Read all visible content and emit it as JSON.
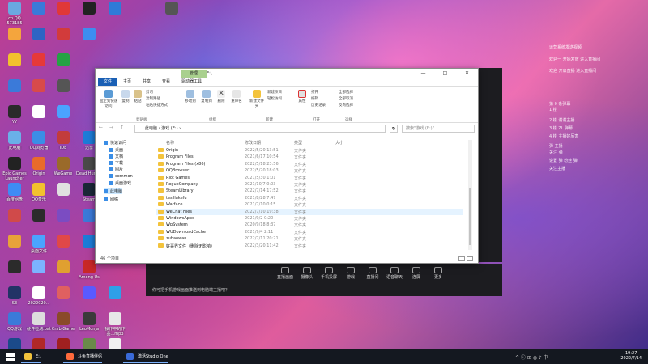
{
  "desktop_icons": [
    {
      "label": "cn QQ 573185",
      "color": "#6aa8e0"
    },
    {
      "label": "",
      "color": "#3b7ad9"
    },
    {
      "label": "",
      "color": "#e03838"
    },
    {
      "label": "",
      "color": "#222"
    },
    {
      "label": "",
      "color": "#2f7bd8"
    },
    {
      "label": "",
      "color": "#555"
    },
    {
      "label": "",
      "color": "#f4a53d"
    },
    {
      "label": "",
      "color": "#2e64c4"
    },
    {
      "label": "",
      "color": "#d23b3b"
    },
    {
      "label": "",
      "color": "#3d8ef0"
    },
    {
      "label": "",
      "color": "#f2c12e"
    },
    {
      "label": "",
      "color": "#e63939"
    },
    {
      "label": "",
      "color": "#25a244"
    },
    {
      "label": "",
      "color": "#3b7ad9"
    },
    {
      "label": "",
      "color": "#d84a4a"
    },
    {
      "label": "",
      "color": "#555"
    },
    {
      "label": "YY",
      "color": "#2a2a2a"
    },
    {
      "label": "",
      "color": "#fff"
    },
    {
      "label": "",
      "color": "#4aa3ff"
    },
    {
      "label": "此电脑",
      "color": "#6ab0e8"
    },
    {
      "label": "QQ浏览器",
      "color": "#3a8ee6"
    },
    {
      "label": "IDE",
      "color": "#c23c3c"
    },
    {
      "label": "迅雷",
      "color": "#1c7cd8"
    },
    {
      "label": "Epic Games Launcher",
      "color": "#222"
    },
    {
      "label": "Origin",
      "color": "#e96b2b"
    },
    {
      "label": "WeGame",
      "color": "#9a6a2a"
    },
    {
      "label": "Dead Hunter",
      "color": "#4a4a4a"
    },
    {
      "label": "百度网盘",
      "color": "#3e8bf4"
    },
    {
      "label": "QQ音乐",
      "color": "#f2c12e"
    },
    {
      "label": "",
      "color": "#e0e0e0"
    },
    {
      "label": "Steam",
      "color": "#1b2838"
    },
    {
      "label": "",
      "color": "#d04a4a"
    },
    {
      "label": "",
      "color": "#2b2b2b"
    },
    {
      "label": "",
      "color": "#7b4cc2"
    },
    {
      "label": "",
      "color": "#3b7ad9"
    },
    {
      "label": "",
      "color": "#e8a23a"
    },
    {
      "label": "桌面文件",
      "color": "#4aa3ff"
    },
    {
      "label": "",
      "color": "#e04848"
    },
    {
      "label": "",
      "color": "#1c7cd8"
    },
    {
      "label": "",
      "color": "#2b2b2b"
    },
    {
      "label": "",
      "color": "#7cb3ff"
    },
    {
      "label": "",
      "color": "#e0a030"
    },
    {
      "label": "Among Us",
      "color": "#c82828"
    },
    {
      "label": "SE",
      "color": "#223366"
    },
    {
      "label": "2022020...",
      "color": "#fff"
    },
    {
      "label": "",
      "color": "#e06060"
    },
    {
      "label": "",
      "color": "#5a5aff"
    },
    {
      "label": "",
      "color": "#2ea0e8"
    },
    {
      "label": "QQ游戏",
      "color": "#3b7ad9"
    },
    {
      "label": "硬件检测.bat",
      "color": "#ddd"
    },
    {
      "label": "Crab Game",
      "color": "#8a4a2a"
    },
    {
      "label": "LeoMonja",
      "color": "#3a3a3a"
    },
    {
      "label": "操作中的作品...mp3",
      "color": "#e8e8e8"
    },
    {
      "label": "Studio One 5",
      "color": "#1b4a8a"
    },
    {
      "label": "Apex Legends",
      "color": "#b02828"
    },
    {
      "label": "Dota 2",
      "color": "#a02020"
    },
    {
      "label": "人狼一起手绘 Human Fa...",
      "color": "#6a8a4a"
    },
    {
      "label": "新建文本文档.txt",
      "color": "#f0f0f0"
    }
  ],
  "side_panel": {
    "lines": [
      "运营系统发送视频",
      "欢迎一 开始发放 进入直播间",
      "欢迎 开启直播 进入直播间",
      "第 0 条弹幕",
      "1 楼",
      "2 楼 谢谢主播",
      "3 楼 ZL 弹幕",
      "4 楼 主播好厉害",
      "弹 主播",
      "关注 弹",
      "设置 弹 粉丝 弹",
      "关注主播"
    ]
  },
  "window": {
    "ctx_tab": "管理",
    "title": "E:\\",
    "min": "—",
    "max": "□",
    "close": "✕",
    "help": "^",
    "tabs": [
      "文件",
      "主页",
      "共享",
      "查看",
      "驱动器工具"
    ],
    "ribbon": {
      "pin": "固定到快速访问",
      "copy": "复制",
      "paste": "粘贴",
      "copy_path": "复制路径",
      "paste_shortcut": "粘贴快捷方式",
      "cut": "剪切",
      "move_to": "移动到",
      "copy_to": "复制到",
      "delete": "删除",
      "rename": "重命名",
      "new_folder": "新建文件夹",
      "new_item": "新建项目",
      "easy_access": "轻松访问",
      "properties": "属性",
      "open": "打开",
      "edit": "编辑",
      "history": "历史记录",
      "select_all": "全部选择",
      "select_none": "全部取消",
      "invert": "反向选择",
      "group_clipboard": "剪贴板",
      "group_organize": "组织",
      "group_new": "新建",
      "group_open": "打开",
      "group_select": "选择"
    },
    "address": {
      "path": "此电脑 › 游戏 (E:) ›",
      "nav": "← → ↑",
      "refresh": "↻",
      "search_placeholder": "搜索\"游戏 (E:)\""
    },
    "columns": {
      "name": "名称",
      "date": "修改日期",
      "type": "类型",
      "size": "大小"
    },
    "nav_pane": [
      {
        "label": "快速访问",
        "sel": false
      },
      {
        "label": "桌面",
        "sel": false
      },
      {
        "label": "文档",
        "sel": false
      },
      {
        "label": "下载",
        "sel": false
      },
      {
        "label": "图片",
        "sel": false
      },
      {
        "label": "common",
        "sel": false
      },
      {
        "label": "桌面游戏",
        "sel": false
      },
      {
        "label": "此电脑",
        "sel": true
      },
      {
        "label": "网络",
        "sel": false
      }
    ],
    "files": [
      {
        "name": "Origin",
        "date": "2022/5/20 13:51",
        "type": "文件夹",
        "hl": false
      },
      {
        "name": "Program Files",
        "date": "2021/6/17 10:54",
        "type": "文件夹",
        "hl": false
      },
      {
        "name": "Program Files (x86)",
        "date": "2022/5/18 23:56",
        "type": "文件夹",
        "hl": false
      },
      {
        "name": "QQBrowser",
        "date": "2022/5/20 18:03",
        "type": "文件夹",
        "hl": false
      },
      {
        "name": "Riot Games",
        "date": "2021/5/30 1:01",
        "type": "文件夹",
        "hl": false
      },
      {
        "name": "RogueCompany",
        "date": "2021/10/7 0:03",
        "type": "文件夹",
        "hl": false
      },
      {
        "name": "SteamLibrary",
        "date": "2022/7/14 17:52",
        "type": "文件夹",
        "hl": false
      },
      {
        "name": "tesillakefu",
        "date": "2021/8/28 7:47",
        "type": "文件夹",
        "hl": false
      },
      {
        "name": "Warface",
        "date": "2021/7/10 0:15",
        "type": "文件夹",
        "hl": false
      },
      {
        "name": "WeChat Files",
        "date": "2022/7/10 19:38",
        "type": "文件夹",
        "hl": true
      },
      {
        "name": "WindowsApps",
        "date": "2021/9/2 0:20",
        "type": "文件夹",
        "hl": false
      },
      {
        "name": "WpSystem",
        "date": "2020/9/18 8:37",
        "type": "文件夹",
        "hl": false
      },
      {
        "name": "WUDownloadCache",
        "date": "2021/9/4 2:11",
        "type": "文件夹",
        "hl": false
      },
      {
        "name": "zuhaowan",
        "date": "2022/7/11 20:21",
        "type": "文件夹",
        "hl": false
      },
      {
        "name": "好哥界文件（删除无影响）",
        "date": "2022/3/20 11:42",
        "type": "文件夹",
        "hl": false
      }
    ],
    "status": "46 个项目"
  },
  "live_panel": {
    "tools": [
      "直播画面",
      "摄像头",
      "手机投屏",
      "游戏",
      "直播间",
      "语音聊天",
      "连屏",
      "更多"
    ],
    "tip": "你可把手机游戏画面推送到电脑端主播吧？"
  },
  "taskbar": {
    "apps": [
      {
        "label": "E:\\",
        "color": "#f3c33c"
      },
      {
        "label": "斗鱼直播伴侣",
        "color": "#ff6a3c"
      },
      {
        "label": "激活Studio One",
        "color": "#3a6ad8"
      }
    ],
    "tray": "^ ⓘ ⊞ ◍ ♪ 中",
    "time": "19:27",
    "date": "2022/7/14"
  }
}
